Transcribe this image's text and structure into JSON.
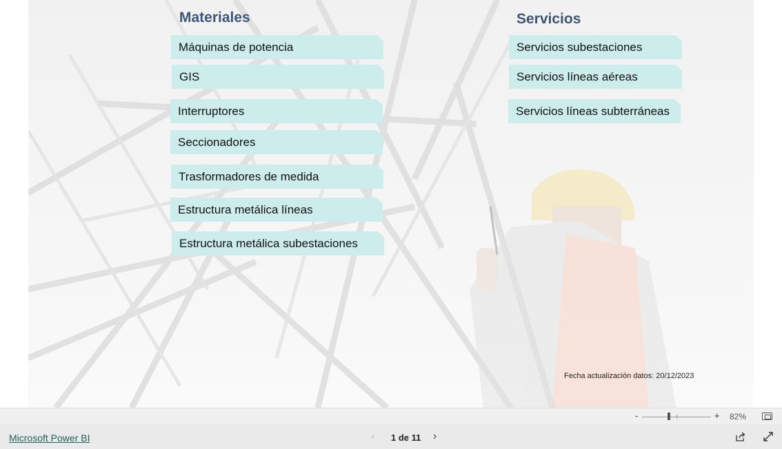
{
  "report": {
    "materiales_heading": "Materiales",
    "servicios_heading": "Servicios",
    "materiales": [
      "Máquinas de potencia",
      "GIS",
      "Interruptores",
      "Seccionadores",
      "Trasformadores de medida",
      "Estructura metálica líneas",
      "Estructura metálica subestaciones"
    ],
    "servicios": [
      "Servicios subestaciones",
      "Servicios líneas aéreas",
      "Servicios líneas subterráneas"
    ],
    "fecha_actualizacion": "Fecha actualización datos: 20/12/2023"
  },
  "zoom": {
    "minus": "-",
    "plus": "+",
    "level": "82%"
  },
  "footer": {
    "brand_link": "Microsoft Power BI",
    "page_indicator": "1 de 11"
  },
  "colors": {
    "button_bg": "#cdecec",
    "heading": "#3f5576",
    "brand_link": "#1d5f5a"
  },
  "icons": {
    "prev": "chevron-left-icon",
    "next": "chevron-right-icon",
    "share": "share-icon",
    "expand": "expand-icon",
    "fit": "fit-to-page-icon"
  }
}
